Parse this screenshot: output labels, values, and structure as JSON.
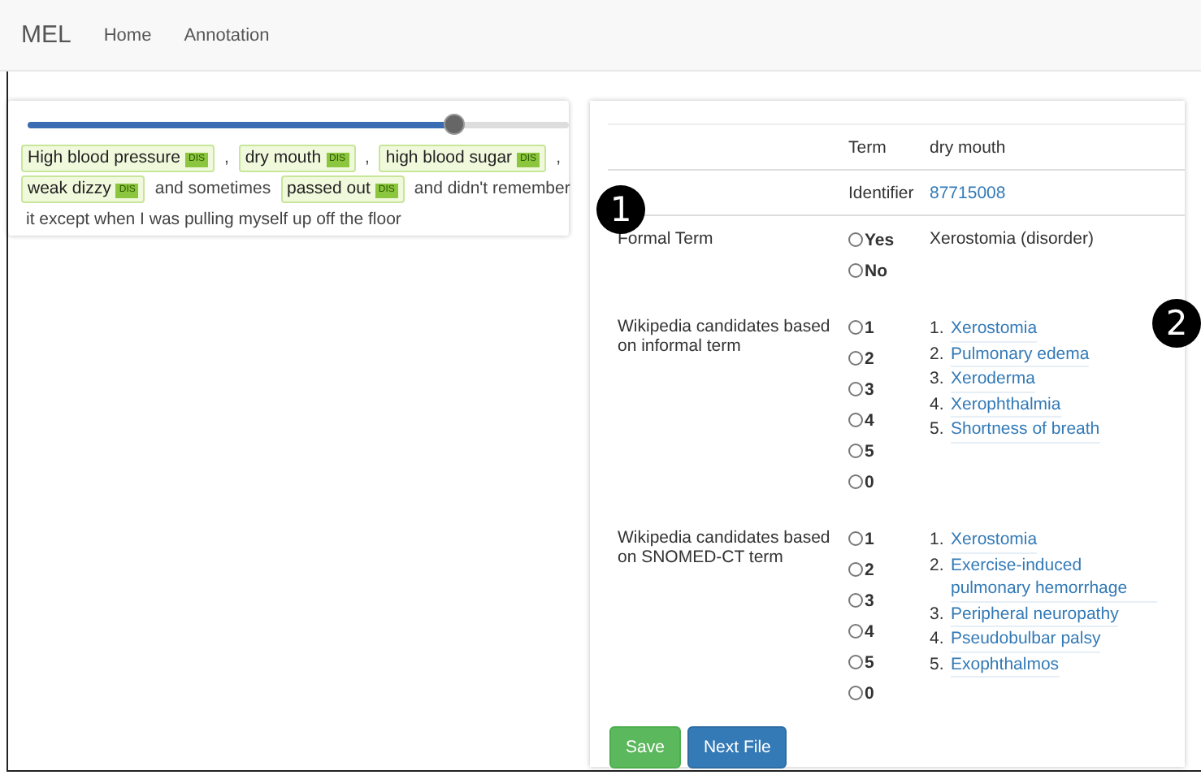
{
  "navbar": {
    "brand": "MEL",
    "links": [
      {
        "label": "Home",
        "selected": false
      },
      {
        "label": "Annotation",
        "selected": false
      }
    ]
  },
  "text_panel": {
    "slider": {
      "level": 0.79
    },
    "segments": [
      {
        "kind": "entity",
        "text": "High blood pressure",
        "tag": "DIS"
      },
      {
        "kind": "text",
        "text": ","
      },
      {
        "kind": "entity",
        "text": "dry mouth",
        "tag": "DIS"
      },
      {
        "kind": "text",
        "text": ","
      },
      {
        "kind": "entity",
        "text": "high blood sugar",
        "tag": "DIS"
      },
      {
        "kind": "text",
        "text": ","
      },
      {
        "kind": "entity",
        "text": "weak dizzy",
        "tag": "DIS"
      },
      {
        "kind": "text",
        "text": "and sometimes"
      },
      {
        "kind": "entity",
        "text": "passed out",
        "tag": "DIS"
      },
      {
        "kind": "text",
        "text": "and didn't remember"
      },
      {
        "kind": "text",
        "text": "it except when I was pulling myself up off the floor"
      }
    ]
  },
  "annotation_panel": {
    "term": {
      "label": "Term",
      "value": "dry mouth"
    },
    "identifier": {
      "label": "Identifier",
      "value": "87715008"
    },
    "formal_term": {
      "label": "Formal Term",
      "options": [
        {
          "label": "Yes",
          "selected": false
        },
        {
          "label": "No",
          "selected": false
        }
      ],
      "value": "Xerostomia (disorder)"
    },
    "candidate_groups": [
      {
        "label": "Wikipedia candidates based on informal term",
        "options": [
          {
            "label": "1",
            "selected": false
          },
          {
            "label": "2",
            "selected": false
          },
          {
            "label": "3",
            "selected": false
          },
          {
            "label": "4",
            "selected": false
          },
          {
            "label": "5",
            "selected": false
          },
          {
            "label": "0",
            "selected": false
          }
        ],
        "candidates": [
          {
            "number": "1.",
            "title": "Xerostomia"
          },
          {
            "number": "2.",
            "title": "Pulmonary edema"
          },
          {
            "number": "3.",
            "title": "Xeroderma"
          },
          {
            "number": "4.",
            "title": "Xerophthalmia"
          },
          {
            "number": "5.",
            "title": "Shortness of breath"
          }
        ]
      },
      {
        "label": "Wikipedia candidates based on SNOMED-CT term",
        "options": [
          {
            "label": "1",
            "selected": false
          },
          {
            "label": "2",
            "selected": false
          },
          {
            "label": "3",
            "selected": false
          },
          {
            "label": "4",
            "selected": false
          },
          {
            "label": "5",
            "selected": false
          },
          {
            "label": "0",
            "selected": false
          }
        ],
        "candidates": [
          {
            "number": "1.",
            "title": "Xerostomia"
          },
          {
            "number": "2.",
            "title": "Exercise-induced pulmonary hemorrhage"
          },
          {
            "number": "3.",
            "title": "Peripheral neuropathy"
          },
          {
            "number": "4.",
            "title": "Pseudobulbar palsy"
          },
          {
            "number": "5.",
            "title": "Exophthalmos"
          }
        ]
      }
    ],
    "buttons": [
      {
        "kind": "success",
        "label": "Save"
      },
      {
        "kind": "primary",
        "label": "Next File"
      }
    ]
  },
  "callouts": [
    "1",
    "2"
  ]
}
